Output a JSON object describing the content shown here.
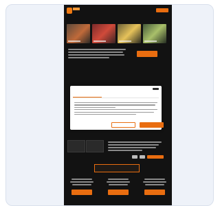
{
  "site": {
    "brand": "",
    "nav": [
      "",
      "",
      "",
      "",
      ""
    ],
    "header_button": "",
    "hero_title": "",
    "intro_button": "",
    "section_title": "",
    "columns": [
      {
        "heading": "",
        "button": ""
      },
      {
        "heading": "",
        "button": ""
      },
      {
        "heading": "",
        "button": ""
      }
    ]
  },
  "consent": {
    "tabs": [
      "",
      "",
      ""
    ],
    "active_tab": 0,
    "heading": "",
    "buttons": {
      "secondary": "",
      "primary": ""
    }
  },
  "colors": {
    "accent": "#e96d10",
    "site_background": "#121212",
    "page_background": "#eef2f9",
    "dialog_background": "#ffffff"
  }
}
